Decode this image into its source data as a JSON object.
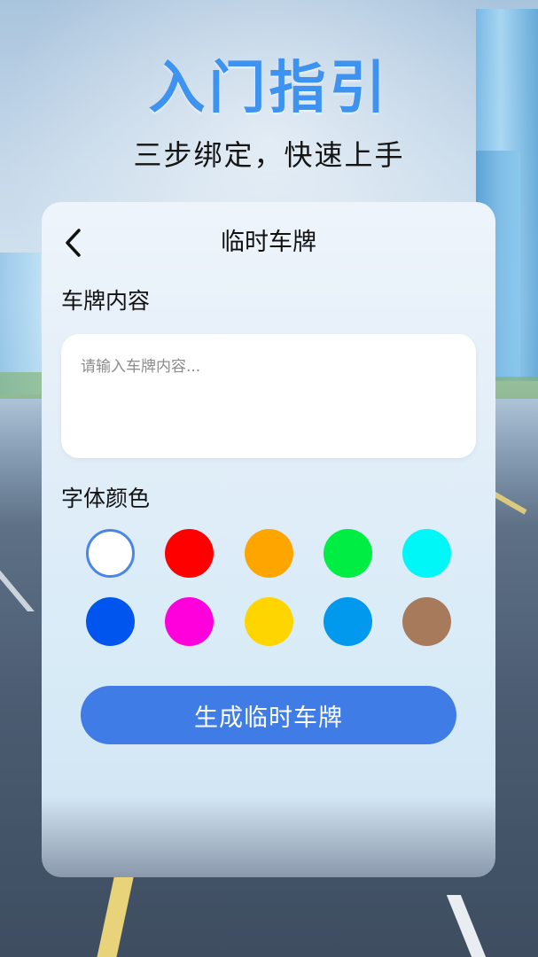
{
  "page": {
    "title": "入门指引",
    "subtitle": "三步绑定，快速上手"
  },
  "card": {
    "title": "临时车牌",
    "content_label": "车牌内容",
    "input": {
      "value": "",
      "placeholder": "请输入车牌内容..."
    },
    "color_label": "字体颜色",
    "colors": [
      {
        "hex": "#ffffff",
        "selected": true
      },
      {
        "hex": "#ff0000",
        "selected": false
      },
      {
        "hex": "#ffa500",
        "selected": false
      },
      {
        "hex": "#00ee44",
        "selected": false
      },
      {
        "hex": "#00f7f7",
        "selected": false
      },
      {
        "hex": "#0055ee",
        "selected": false
      },
      {
        "hex": "#ff00dd",
        "selected": false
      },
      {
        "hex": "#ffd500",
        "selected": false
      },
      {
        "hex": "#0099ee",
        "selected": false
      },
      {
        "hex": "#a87a5c",
        "selected": false
      }
    ],
    "generate_button": "生成临时车牌",
    "accent_color": "#3f7ce6"
  }
}
